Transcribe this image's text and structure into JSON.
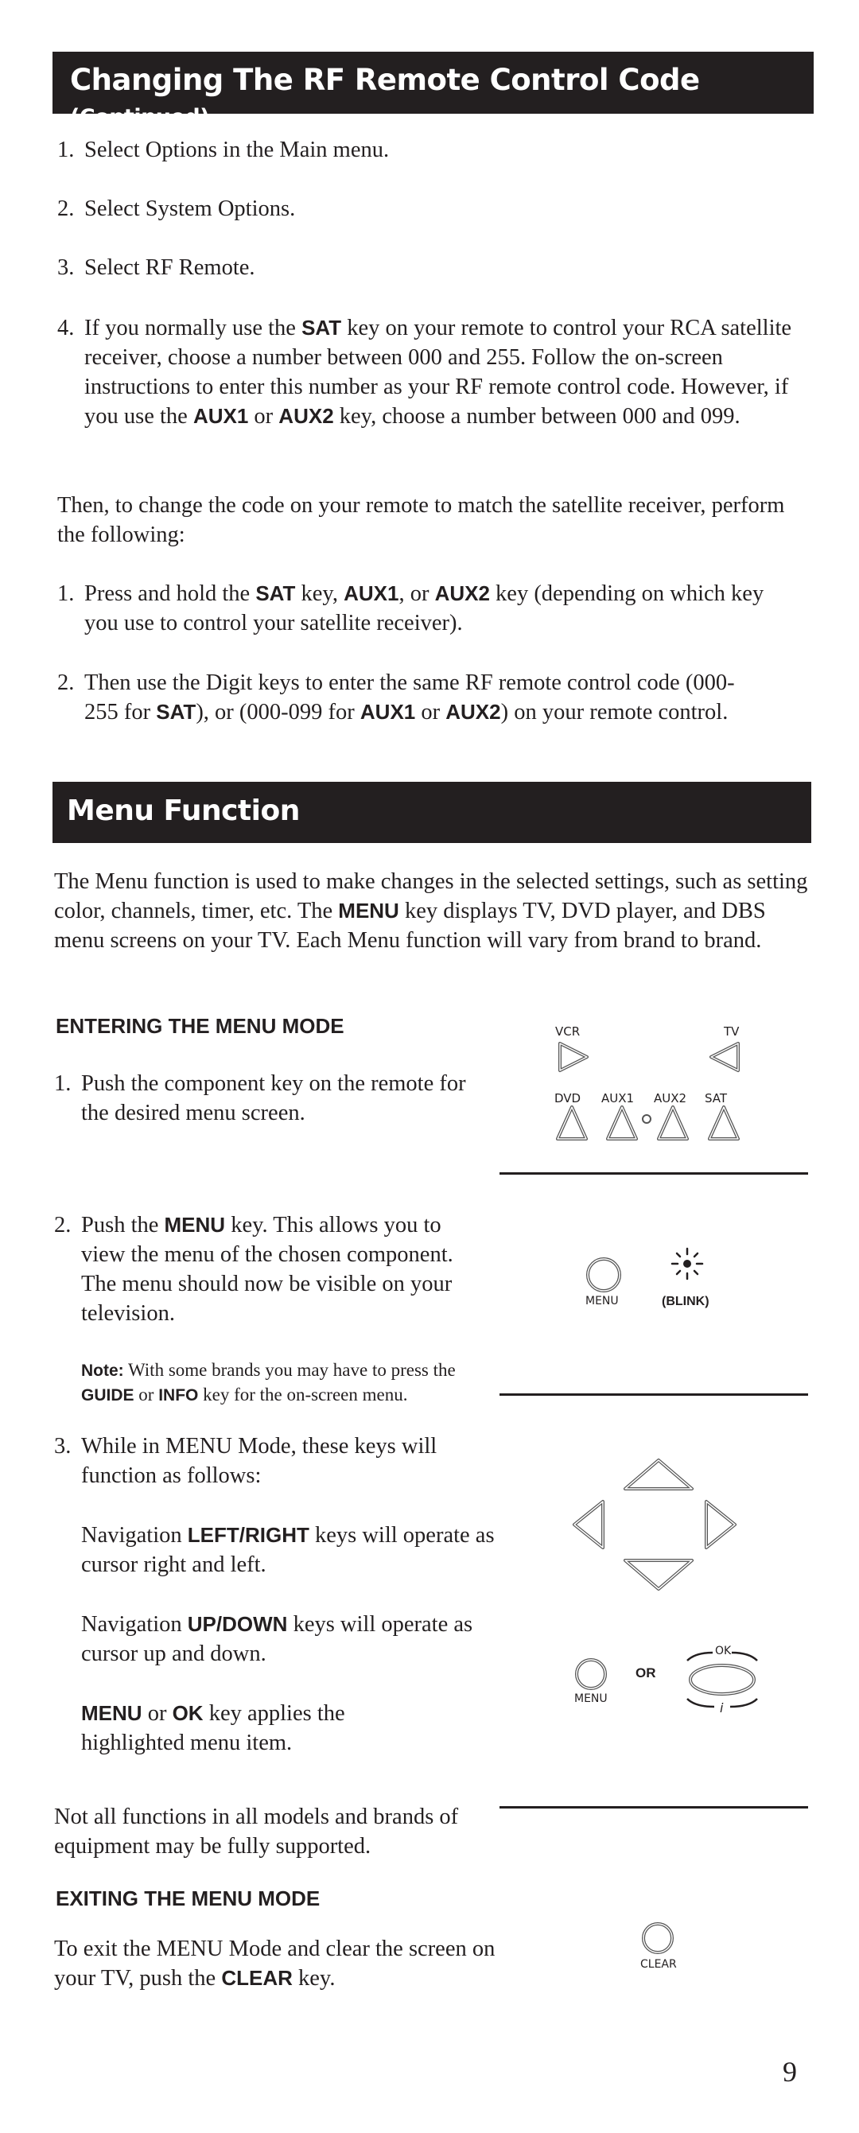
{
  "section1": {
    "title": "Changing The RF Remote Control Code",
    "title_suffix": "(Continued)",
    "steps": [
      {
        "num": "1.",
        "text": "Select Options in the Main menu."
      },
      {
        "num": "2.",
        "text": "Select System Options."
      },
      {
        "num": "3.",
        "text": "Select RF Remote."
      }
    ],
    "step4": {
      "num": "4.",
      "t1": "If you normally use the ",
      "k1": "SAT",
      "t2": " key on your remote to control your RCA satellite receiver, choose a number between 000 and 255. Follow the on-screen instructions to enter this number as your RF remote control code. However, if you use the ",
      "k2": "AUX1",
      "t3": " or ",
      "k3": "AUX2",
      "t4": " key, choose a number between 000 and 099."
    },
    "then_text": "Then, to change the code on your remote to match the satellite receiver, perform the following:",
    "substep1": {
      "num": "1.",
      "t1": "Press and hold the ",
      "k1": "SAT",
      "t2": " key, ",
      "k2": "AUX1",
      "t3": ", or ",
      "k3": "AUX2",
      "t4": " key (depending on which key you use to control your satellite receiver)."
    },
    "substep2": {
      "num": "2.",
      "t1": "Then use the Digit keys to enter the same RF remote control code (000-255 for ",
      "k1": "SAT",
      "t2": "), or (000-099 for ",
      "k2": "AUX1",
      "t3": " or ",
      "k3": "AUX2",
      "t4": ") on your remote control."
    }
  },
  "section2": {
    "title": "Menu Function",
    "intro": {
      "t1": "The Menu function is used to make changes in the selected settings, such as setting color, channels, timer, etc. The ",
      "k1": "MENU",
      "t2": " key displays TV, DVD player, and DBS menu screens on your TV. Each Menu function will vary from brand to brand."
    },
    "entering_heading": "ENTERING THE MENU MODE",
    "step1": {
      "num": "1.",
      "text": "Push the component key on the remote for the desired menu screen."
    },
    "component_keys": {
      "vcr": "VCR",
      "tv": "TV",
      "dvd": "DVD",
      "aux1": "AUX1",
      "aux2": "AUX2",
      "sat": "SAT"
    },
    "step2": {
      "num": "2.",
      "t1": "Push the ",
      "k1": "MENU",
      "t2": " key. This allows you to view the menu of the chosen component. The menu should now be visible on your television."
    },
    "note": {
      "label": "Note:",
      "t1": " With some brands you may have to press the ",
      "k1": "GUIDE",
      "t2": " or ",
      "k2": "INFO",
      "t3": " key for the on-screen menu."
    },
    "menu_key_label": "MENU",
    "blink_label": "(BLINK)",
    "step3": {
      "num": "3.",
      "text": "While in MENU Mode, these keys will function as follows:"
    },
    "nav_lr": {
      "t1": "Navigation ",
      "k1": "LEFT/RIGHT",
      "t2": " keys will operate as cursor right and left."
    },
    "nav_ud": {
      "t1": "Navigation ",
      "k1": "UP/DOWN",
      "t2": " keys will operate as cursor up and down."
    },
    "apply": {
      "k1": "MENU",
      "t1": " or ",
      "k2": "OK",
      "t2": " key applies the highlighted menu item."
    },
    "or_label": "OR",
    "ok_label": "OK",
    "info_label": "i",
    "support_note": "Not all functions in all models and brands of equipment may be fully supported.",
    "exiting_heading": "EXITING THE MENU MODE",
    "exit": {
      "t1": "To exit the MENU Mode and clear the screen on your TV, push the ",
      "k1": "CLEAR",
      "t2": " key."
    },
    "clear_key_label": "CLEAR"
  },
  "page_number": "9"
}
